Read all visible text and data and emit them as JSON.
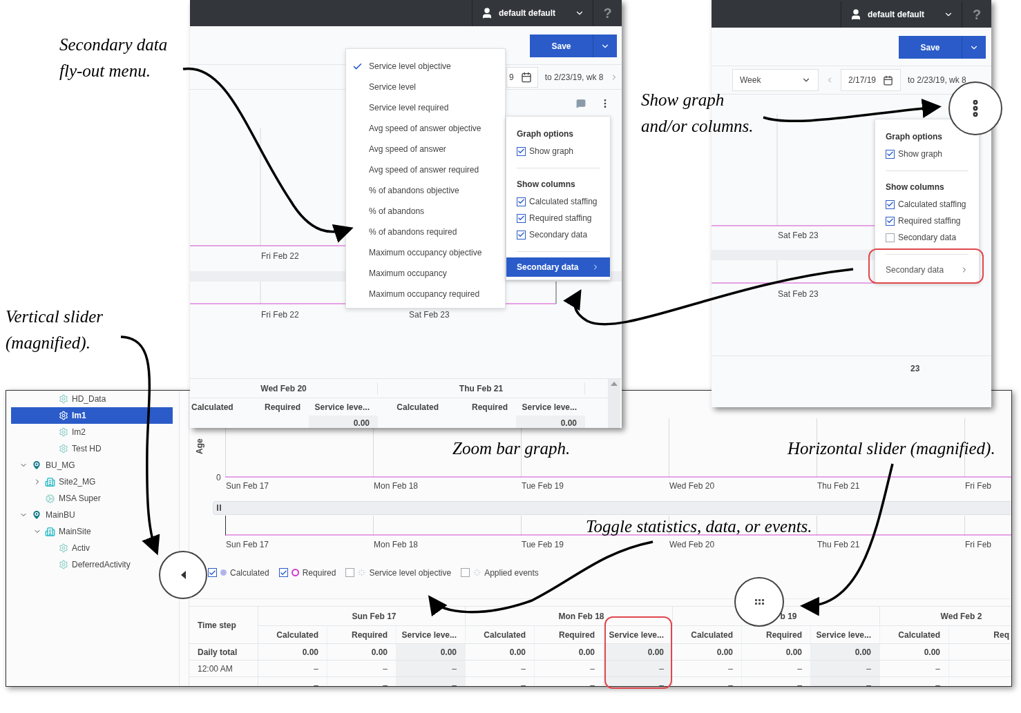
{
  "annotations": [
    {
      "lines": [
        "Secondary data",
        "fly-out menu."
      ]
    },
    {
      "lines": [
        "Show graph",
        "and/or columns."
      ]
    },
    {
      "lines": [
        "Vertical slider",
        "(magnified)."
      ]
    },
    {
      "lines": [
        "Zoom bar graph."
      ]
    },
    {
      "lines": [
        "Horizontal slider (magnified)."
      ]
    },
    {
      "lines": [
        "Toggle statistics, data, or events."
      ]
    }
  ],
  "flyout_view": {
    "user": "default default",
    "help": "?",
    "save": "Save",
    "date_fragment": "9",
    "date_range": "to 2/23/19, wk 8",
    "chart_labels": [
      "Fri Feb 22"
    ],
    "overview_labels": [
      "Fri Feb 22",
      "Sat Feb 23"
    ],
    "secondary_menu": [
      {
        "label": "Service level objective",
        "checked": true
      },
      {
        "label": "Service level",
        "checked": false
      },
      {
        "label": "Service level required",
        "checked": false
      },
      {
        "label": "Avg speed of answer objective",
        "checked": false
      },
      {
        "label": "Avg speed of answer",
        "checked": false
      },
      {
        "label": "Avg speed of answer required",
        "checked": false
      },
      {
        "label": "% of abandons objective",
        "checked": false
      },
      {
        "label": "% of abandons",
        "checked": false
      },
      {
        "label": "% of abandons required",
        "checked": false
      },
      {
        "label": "Maximum occupancy objective",
        "checked": false
      },
      {
        "label": "Maximum occupancy",
        "checked": false
      },
      {
        "label": "Maximum occupancy required",
        "checked": false
      }
    ],
    "options": {
      "graph_title": "Graph options",
      "graph_items": [
        {
          "label": "Show graph",
          "checked": true
        }
      ],
      "columns_title": "Show columns",
      "column_items": [
        {
          "label": "Calculated staffing",
          "checked": true
        },
        {
          "label": "Required staffing",
          "checked": true
        },
        {
          "label": "Secondary data",
          "checked": true
        }
      ],
      "submenu": {
        "label": "Secondary data",
        "selected": true
      }
    },
    "table": {
      "days": [
        "Wed Feb 20",
        "Thu Feb 21"
      ],
      "columns": [
        {
          "label": "Calculated",
          "kind": "staffing"
        },
        {
          "label": "Required",
          "kind": "staffing"
        },
        {
          "label": "Service leve...",
          "kind": "secondary"
        },
        {
          "label": "Calculated",
          "kind": "staffing"
        },
        {
          "label": "Required",
          "kind": "staffing"
        },
        {
          "label": "Service leve...",
          "kind": "secondary"
        }
      ],
      "cells": [
        "0.00",
        "0.00"
      ]
    }
  },
  "options_view": {
    "user": "default default",
    "help": "?",
    "save": "Save",
    "period": "Week",
    "start_date": "2/17/19",
    "date_range": "to 2/23/19, wk 8",
    "chart_labels": [
      "Sat Feb 23"
    ],
    "overview_labels": [
      "Sat Feb 23"
    ],
    "table_fragment": "23",
    "options": {
      "graph_title": "Graph options",
      "graph_items": [
        {
          "label": "Show graph",
          "checked": true
        }
      ],
      "columns_title": "Show columns",
      "column_items": [
        {
          "label": "Calculated staffing",
          "checked": true
        },
        {
          "label": "Required staffing",
          "checked": true
        },
        {
          "label": "Secondary data",
          "checked": false
        }
      ],
      "submenu": {
        "label": "Secondary data",
        "selected": false
      }
    }
  },
  "main_view": {
    "tree_partial": [
      {
        "label": "HD_Data",
        "kind": "activity",
        "selected": false
      },
      {
        "label": "Im1",
        "kind": "activity",
        "selected": true
      },
      {
        "label": "Im2",
        "kind": "activity",
        "selected": false
      },
      {
        "label": "Test HD",
        "kind": "activity",
        "selected": false
      }
    ],
    "tree": [
      {
        "label": "BU_MG",
        "kind": "unit",
        "selected": false,
        "expanded": true,
        "children": [
          {
            "label": "Site2_MG",
            "kind": "site",
            "selected": false,
            "expanded": false
          },
          {
            "label": "MSA Super",
            "kind": "multi",
            "selected": false
          }
        ]
      },
      {
        "label": "MainBU",
        "kind": "unit",
        "selected": false,
        "expanded": true,
        "children": [
          {
            "label": "MainSite",
            "kind": "site",
            "selected": false,
            "expanded": true,
            "children": [
              {
                "label": "Activ",
                "kind": "activity",
                "selected": false
              },
              {
                "label": "DeferredActivity",
                "kind": "activity",
                "selected": false
              }
            ]
          }
        ]
      }
    ],
    "y_axis_label": "Age",
    "y_tick": "0",
    "chart_labels": [
      "Sun Feb 17",
      "Mon Feb 18",
      "Tue Feb 19",
      "Wed Feb 20",
      "Thu Feb 21",
      "Fri Feb"
    ],
    "overview_labels": [
      "Sun Feb 17",
      "Mon Feb 18",
      "Tue Feb 19",
      "Wed Feb 20",
      "Thu Feb 21",
      "Fri Feb"
    ],
    "legend": [
      {
        "label": "Calculated",
        "checked": true,
        "kind": "dot",
        "color": "#b4b4ec"
      },
      {
        "label": "Required",
        "checked": true,
        "kind": "ring",
        "color": "#d53ccf"
      },
      {
        "label": "Service level objective",
        "checked": false,
        "kind": "spinner",
        "color": "#c4c8cc"
      },
      {
        "label": "Applied events",
        "checked": false,
        "kind": "spinner",
        "color": "#c4c8cc"
      }
    ],
    "table": {
      "row_header": "Time step",
      "days": [
        {
          "label": "Sun Feb 17",
          "columns": [
            {
              "label": "Calculated",
              "kind": "staffing"
            },
            {
              "label": "Required",
              "kind": "staffing"
            },
            {
              "label": "Service leve...",
              "kind": "secondary"
            }
          ]
        },
        {
          "label": "Mon Feb 18",
          "columns": [
            {
              "label": "Calculated",
              "kind": "staffing"
            },
            {
              "label": "Required",
              "kind": "staffing"
            },
            {
              "label": "Service leve...",
              "kind": "secondary"
            }
          ]
        },
        {
          "label": "b 19",
          "columns": [
            {
              "label": "Calculated",
              "kind": "staffing"
            },
            {
              "label": "Required",
              "kind": "staffing"
            },
            {
              "label": "Service leve...",
              "kind": "secondary"
            }
          ]
        },
        {
          "label": "Wed Feb 2",
          "columns": [
            {
              "label": "Calculated",
              "kind": "staffing"
            },
            {
              "label": "Req",
              "kind": "staffing"
            }
          ]
        }
      ],
      "rows": [
        {
          "label": "Daily total",
          "kind": "total",
          "cells": [
            "0.00",
            "0.00",
            "0.00",
            "0.00",
            "0.00",
            "0.00",
            "0.00",
            "0.00",
            "0.00",
            "0.00"
          ]
        },
        {
          "label": "12:00 AM",
          "kind": "interval",
          "cells": [
            "–",
            "–",
            "–",
            "–",
            "–",
            "–",
            "–",
            "–",
            "–",
            "–"
          ]
        },
        {
          "kind": "interval",
          "cells": [
            "–",
            "–",
            "–",
            "–",
            "–",
            "–",
            "–",
            "–",
            "–",
            "–"
          ]
        }
      ]
    }
  }
}
